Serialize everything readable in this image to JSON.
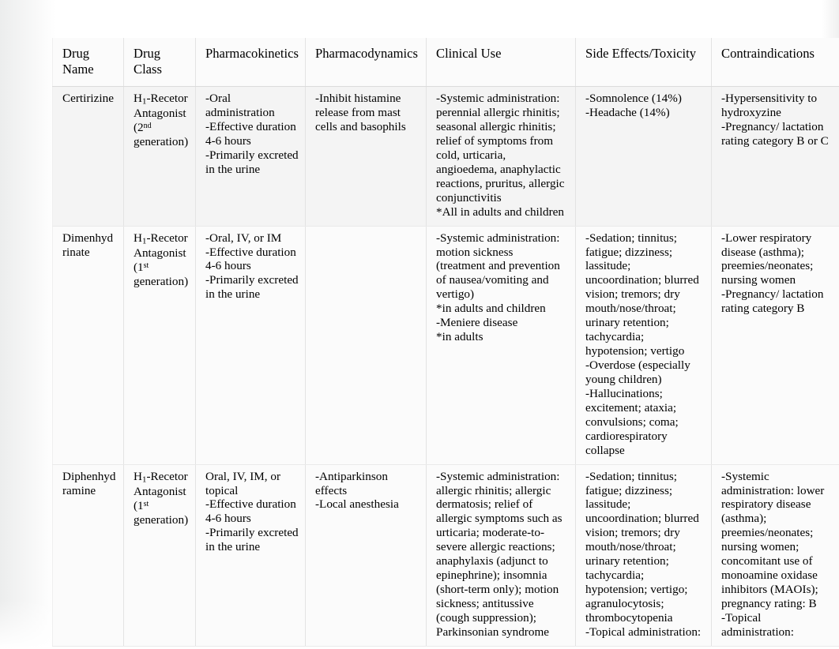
{
  "document": {
    "type": "pharmacology-reference-table",
    "table": {
      "headers": [
        "Drug Name",
        "Drug Class",
        "Pharmacokinetics",
        "Pharmacodynamics",
        "Clinical Use",
        "Side Effects/Toxicity",
        "Contraindications"
      ],
      "rows": [
        {
          "drug_name": "Certirizine",
          "drug_class_main": "H",
          "drug_class_sub": "1",
          "drug_class_rest": "-Recetor Antagonist",
          "drug_class_generation_prefix": "(2",
          "drug_class_generation_sup": "nd",
          "drug_class_generation_suffix": "generation)",
          "pharmacokinetics": "-Oral administration\n-Effective duration 4-6 hours\n-Primarily excreted in the urine",
          "pharmacodynamics": "-Inhibit histamine release from mast cells and basophils",
          "clinical_use": "-Systemic administration: perennial allergic rhinitis; seasonal allergic rhinitis; relief of symptoms from cold, urticaria, angioedema, anaphylactic reactions, pruritus, allergic conjunctivitis\n*All in adults and children",
          "side_effects": "-Somnolence (14%)\n-Headache (14%)",
          "contraindications": "-Hypersensitivity to hydroxyzine\n-Pregnancy/ lactation rating category B or C"
        },
        {
          "drug_name": "Dimenhydrinate",
          "drug_class_main": "H",
          "drug_class_sub": "1",
          "drug_class_rest": "-Recetor Antagonist",
          "drug_class_generation_prefix": "(1",
          "drug_class_generation_sup": "st",
          "drug_class_generation_suffix": "generation)",
          "pharmacokinetics": "-Oral, IV, or IM\n-Effective duration 4-6 hours\n-Primarily excreted in the urine",
          "pharmacodynamics": "",
          "clinical_use": "-Systemic administration: motion sickness\n(treatment and prevention of nausea/vomiting and vertigo)\n*in adults and children\n-Meniere disease\n*in adults",
          "side_effects": "-Sedation; tinnitus; fatigue; dizziness; lassitude; uncoordination; blurred vision; tremors; dry mouth/nose/throat; urinary retention; tachycardia; hypotension; vertigo\n-Overdose (especially young children)\n-Hallucinations; excitement; ataxia; convulsions; coma; cardiorespiratory collapse",
          "contraindications": "-Lower respiratory disease (asthma); preemies/neonates; nursing women\n-Pregnancy/ lactation rating category B"
        },
        {
          "drug_name": "Diphenhydramine",
          "drug_class_main": "H",
          "drug_class_sub": "1",
          "drug_class_rest": "-Recetor Antagonist",
          "drug_class_generation_prefix": "(1",
          "drug_class_generation_sup": "st",
          "drug_class_generation_suffix": "generation)",
          "pharmacokinetics": "Oral, IV, IM, or topical\n-Effective duration 4-6 hours\n-Primarily excreted in the urine",
          "pharmacodynamics": "-Antiparkinson effects\n-Local anesthesia",
          "clinical_use": "-Systemic administration: allergic rhinitis; allergic dermatosis; relief of allergic symptoms such as urticaria; moderate-to-severe allergic reactions; anaphylaxis (adjunct to epinephrine); insomnia (short-term only); motion sickness; antitussive (cough suppression); Parkinsonian syndrome",
          "side_effects": "-Sedation; tinnitus; fatigue; dizziness; lassitude; uncoordination; blurred vision; tremors; dry mouth/nose/throat; urinary retention; tachycardia; hypotension; vertigo; agranulocytosis; thrombocytopenia\n-Topical administration:",
          "contraindications": "-Systemic administration: lower respiratory disease (asthma); preemies/neonates; nursing women; concomitant use of monoamine oxidase inhibitors (MAOIs); pregnancy rating: B\n-Topical administration:"
        }
      ]
    }
  }
}
